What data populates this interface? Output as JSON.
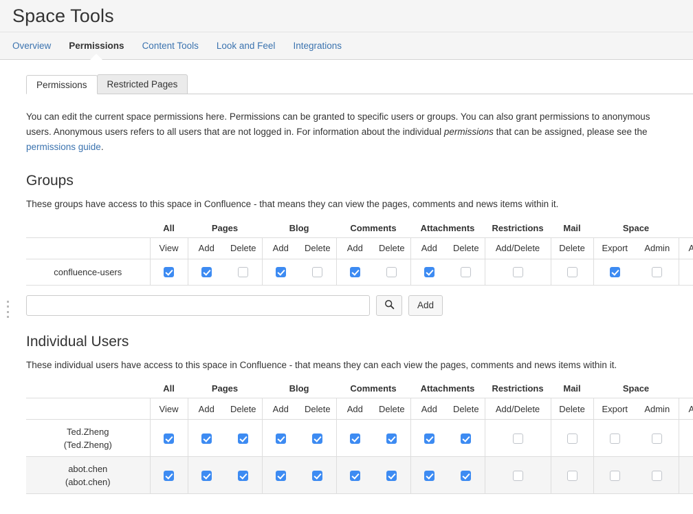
{
  "header": {
    "title": "Space Tools"
  },
  "nav": {
    "items": [
      {
        "label": "Overview",
        "active": false
      },
      {
        "label": "Permissions",
        "active": true
      },
      {
        "label": "Content Tools",
        "active": false
      },
      {
        "label": "Look and Feel",
        "active": false
      },
      {
        "label": "Integrations",
        "active": false
      }
    ]
  },
  "subtabs": [
    {
      "label": "Permissions",
      "active": true
    },
    {
      "label": "Restricted Pages",
      "active": false
    }
  ],
  "intro": {
    "part1": "You can edit the current space permissions here. Permissions can be granted to specific users or groups. You can also grant permissions to anonymous users. Anonymous users refers to all users that are not logged in. For information about the individual ",
    "italic": "permissions",
    "part2": " that can be assigned, please see the ",
    "link": "permissions guide",
    "part3": "."
  },
  "groups_section": {
    "title": "Groups",
    "description": "These groups have access to this space in Confluence - that means they can view the pages, comments and news items within it.",
    "rows": [
      {
        "name": "confluence-users",
        "sub": "",
        "checks": [
          true,
          true,
          false,
          true,
          false,
          true,
          false,
          true,
          false,
          false,
          false,
          true,
          false
        ],
        "actions_icon": "gear-icon"
      }
    ]
  },
  "users_section": {
    "title": "Individual Users",
    "description": "These individual users have access to this space in Confluence - that means they can each view the pages, comments and news items within it.",
    "rows": [
      {
        "name": "Ted.Zheng",
        "sub": "(Ted.Zheng)",
        "checks": [
          true,
          true,
          true,
          true,
          true,
          true,
          true,
          true,
          true,
          false,
          false,
          false,
          false
        ],
        "actions_icon": "gear-icon"
      },
      {
        "name": "abot.chen",
        "sub": "(abot.chen)",
        "checks": [
          true,
          true,
          true,
          true,
          true,
          true,
          true,
          true,
          true,
          false,
          false,
          false,
          false
        ],
        "actions_icon": "gear-icon"
      }
    ]
  },
  "table": {
    "group_headers": [
      {
        "label": "",
        "span": 1
      },
      {
        "label": "All",
        "span": 1
      },
      {
        "label": "Pages",
        "span": 2
      },
      {
        "label": "Blog",
        "span": 2
      },
      {
        "label": "Comments",
        "span": 2
      },
      {
        "label": "Attachments",
        "span": 2
      },
      {
        "label": "Restrictions",
        "span": 1
      },
      {
        "label": "Mail",
        "span": 1
      },
      {
        "label": "Space",
        "span": 2
      },
      {
        "label": "",
        "span": 1
      }
    ],
    "sub_headers": [
      "",
      "View",
      "Add",
      "Delete",
      "Add",
      "Delete",
      "Add",
      "Delete",
      "Add",
      "Delete",
      "Add/Delete",
      "Delete",
      "Export",
      "Admin",
      "Actions"
    ]
  },
  "add_row": {
    "input_value": "",
    "input_placeholder": "",
    "search_icon": "search-icon",
    "add_label": "Add"
  }
}
